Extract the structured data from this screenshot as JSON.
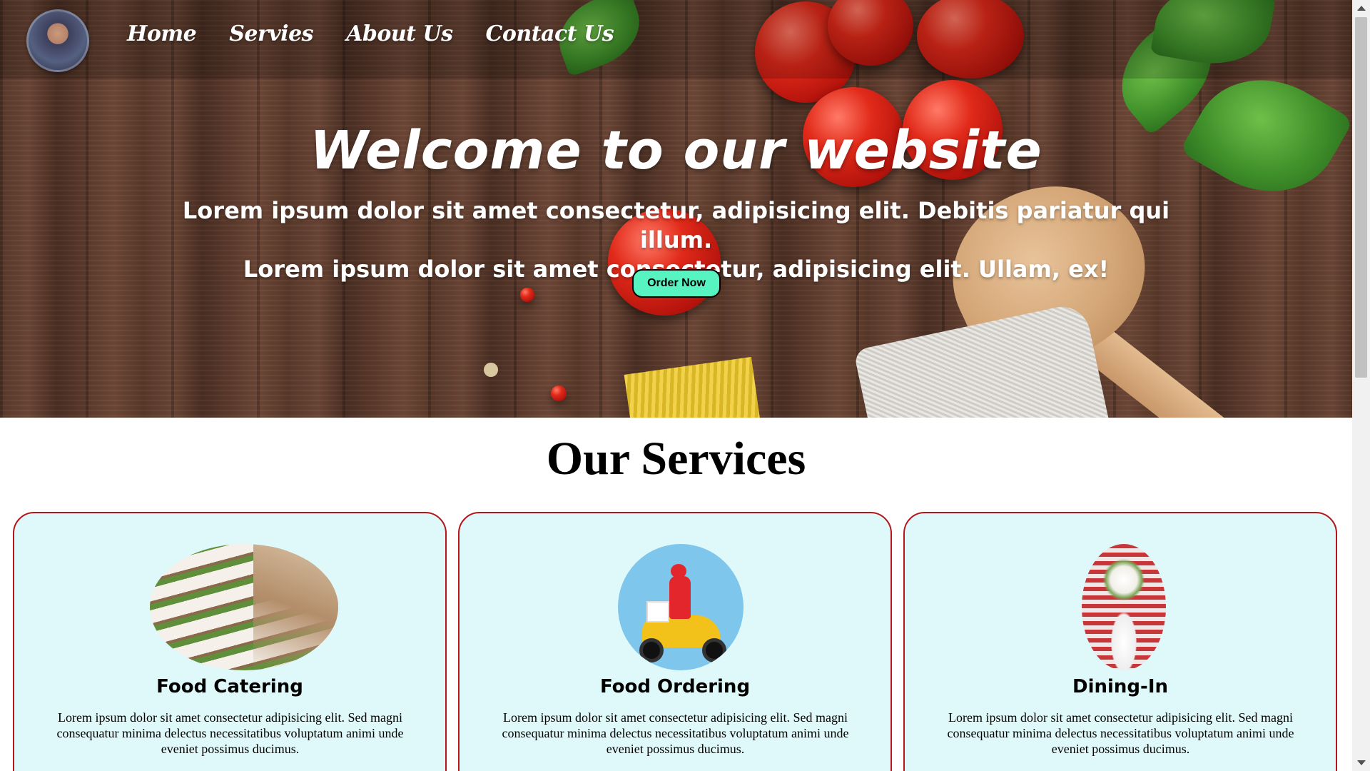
{
  "nav": {
    "links": [
      "Home",
      "Servies",
      "About Us",
      "Contact Us"
    ]
  },
  "hero": {
    "title": "Welcome to our website",
    "subtitle_line1": "Lorem ipsum dolor sit amet consectetur, adipisicing elit. Debitis pariatur qui illum.",
    "subtitle_line2": "Lorem ipsum dolor sit amet consectetur, adipisicing elit. Ullam, ex!",
    "cta_label": "Order Now"
  },
  "services": {
    "title": "Our Services",
    "cards": [
      {
        "title": "Food Catering",
        "text": "Lorem ipsum dolor sit amet consectetur adipisicing elit. Sed magni consequatur minima delectus necessitatibus voluptatum animi unde eveniet possimus ducimus."
      },
      {
        "title": "Food Ordering",
        "text": "Lorem ipsum dolor sit amet consectetur adipisicing elit. Sed magni consequatur minima delectus necessitatibus voluptatum animi unde eveniet possimus ducimus."
      },
      {
        "title": "Dining-In",
        "text": "Lorem ipsum dolor sit amet consectetur adipisicing elit. Sed magni consequatur minima delectus necessitatibus voluptatum animi unde eveniet possimus ducimus."
      }
    ]
  },
  "colors": {
    "cta_background": "#57f3c1",
    "card_background": "#dff9fa",
    "card_border": "#b3171c"
  }
}
